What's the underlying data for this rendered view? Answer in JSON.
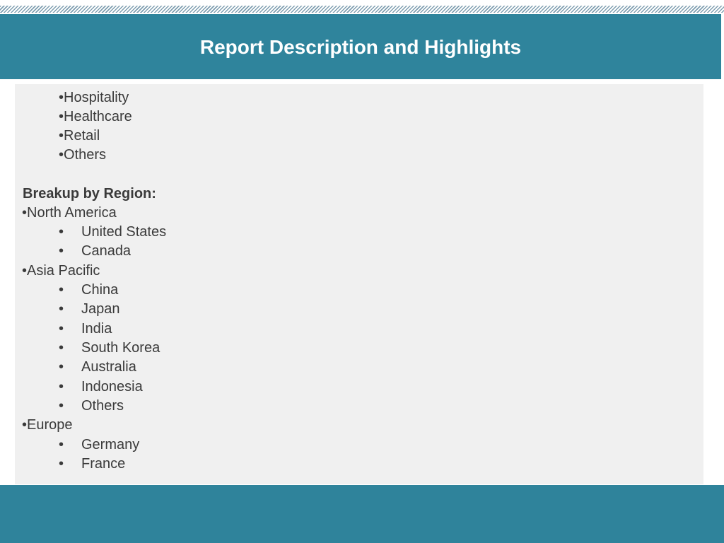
{
  "title": "Report Description and Highlights",
  "industry_items": [
    "Hospitality",
    "Healthcare",
    "Retail",
    "Others"
  ],
  "region_heading": "Breakup by Region:",
  "regions": [
    {
      "name": "North America",
      "countries": [
        "United States",
        "Canada"
      ]
    },
    {
      "name": "Asia Pacific",
      "countries": [
        "China",
        "Japan",
        "India",
        "South Korea",
        "Australia",
        "Indonesia",
        "Others"
      ]
    },
    {
      "name": "Europe",
      "countries": [
        "Germany",
        "France"
      ]
    }
  ],
  "bullet_char": "•",
  "colors": {
    "header": "#2f849c",
    "footer": "#2f839b",
    "content_bg": "#f0f0f0",
    "text": "#3a3a3a"
  }
}
